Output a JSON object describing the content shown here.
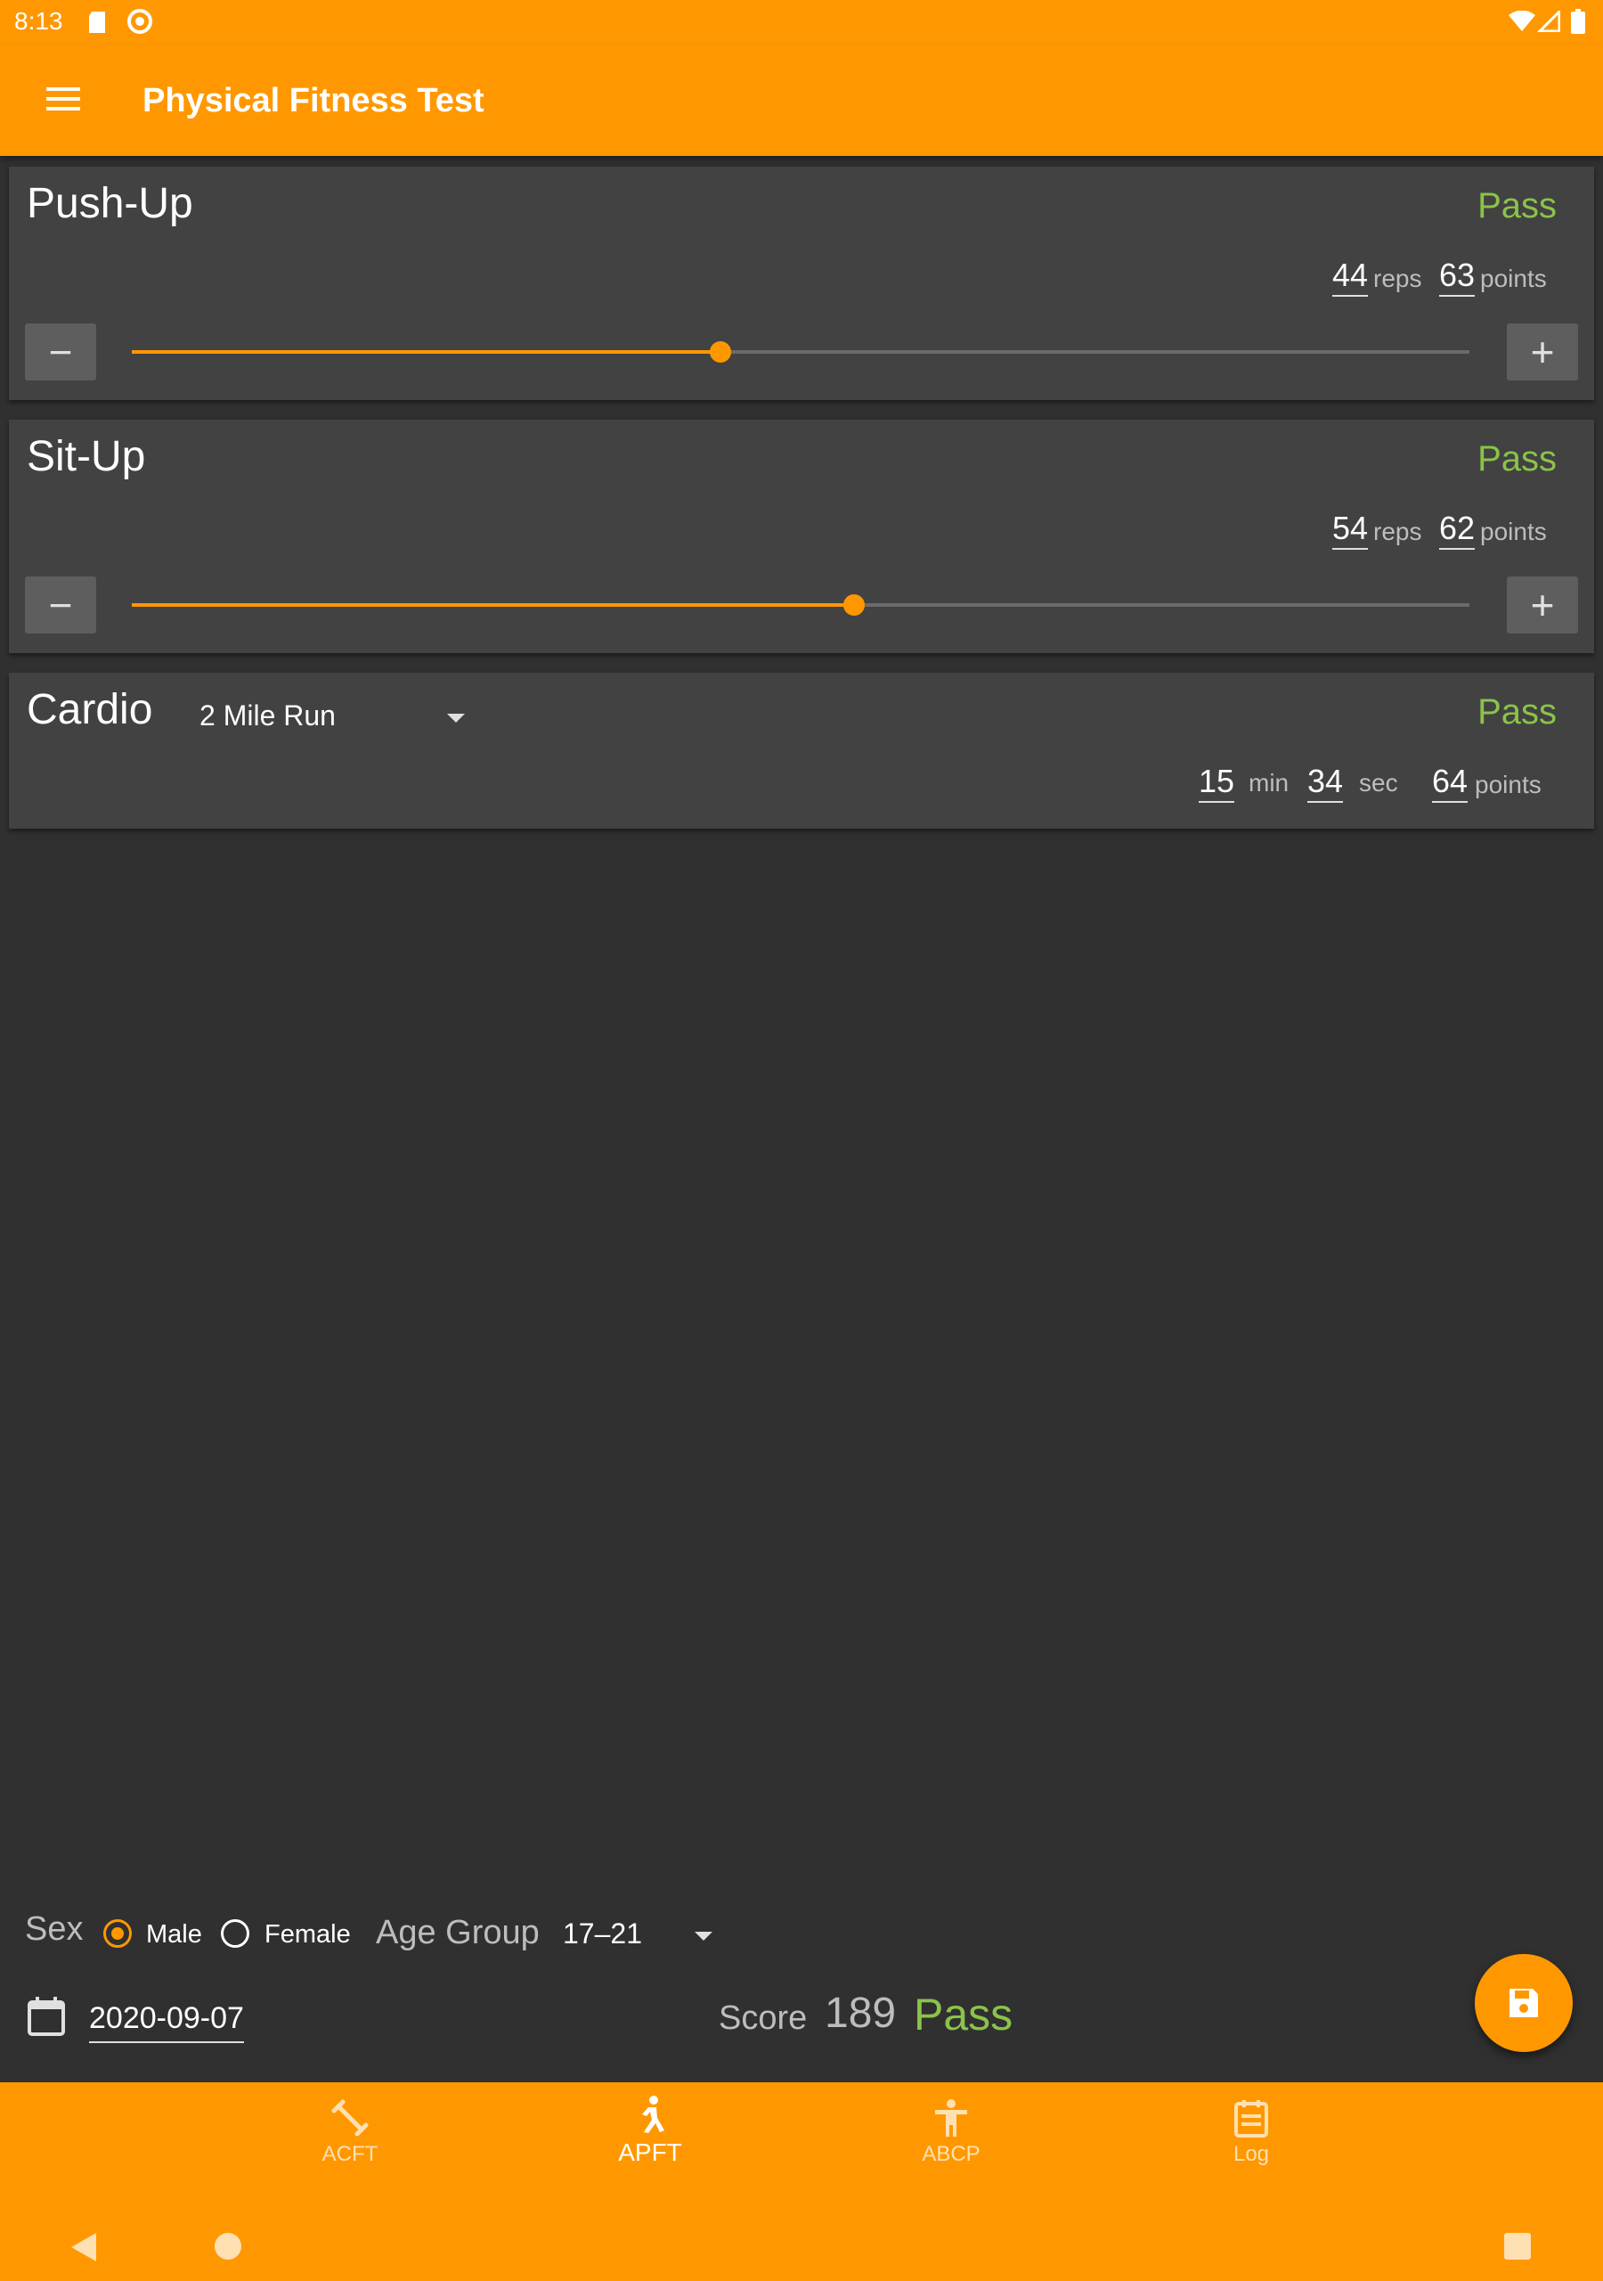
{
  "status_bar": {
    "time": "8:13"
  },
  "app_bar": {
    "title": "Physical Fitness Test"
  },
  "pushup": {
    "title": "Push-Up",
    "status": "Pass",
    "reps": "44",
    "reps_unit": "reps",
    "points": "63",
    "points_unit": "points",
    "minus_label": "−",
    "plus_label": "+",
    "slider_fraction": 0.44
  },
  "situp": {
    "title": "Sit-Up",
    "status": "Pass",
    "reps": "54",
    "reps_unit": "reps",
    "points": "62",
    "points_unit": "points",
    "minus_label": "−",
    "plus_label": "+",
    "slider_fraction": 0.54
  },
  "cardio": {
    "title": "Cardio",
    "event": "2 Mile Run",
    "status": "Pass",
    "minutes": "15",
    "min_unit": "min",
    "seconds": "34",
    "sec_unit": "sec",
    "points": "64",
    "points_unit": "points"
  },
  "profile": {
    "sex_label": "Sex",
    "male_label": "Male",
    "female_label": "Female",
    "selected_sex": "Male",
    "age_group_label": "Age Group",
    "age_group_value": "17–21"
  },
  "test_date": "2020-09-07",
  "score": {
    "label": "Score",
    "value": "189",
    "status": "Pass"
  },
  "bottom_nav": {
    "items": [
      {
        "label": "ACFT",
        "icon": "dumbbell-icon"
      },
      {
        "label": "APFT",
        "icon": "runner-icon"
      },
      {
        "label": "ABCP",
        "icon": "person-icon"
      },
      {
        "label": "Log",
        "icon": "list-icon"
      }
    ],
    "active": "APFT"
  },
  "colors": {
    "accent": "#ff9800",
    "pass": "#8bc34a",
    "background": "#303030",
    "card": "#424242"
  }
}
